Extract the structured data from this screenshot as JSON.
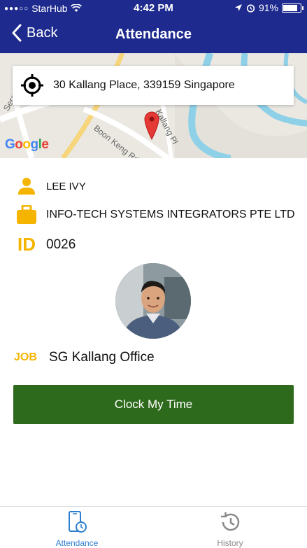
{
  "status_bar": {
    "carrier": "StarHub",
    "time": "4:42 PM",
    "battery_percent": "91%",
    "battery_level": 0.91
  },
  "nav": {
    "back_label": "Back",
    "title": "Attendance"
  },
  "map": {
    "address": "30 Kallang Place, 339159 Singapore",
    "street_labels": [
      "Boon Keng Rd",
      "Kallang Pl",
      "Serangoon"
    ],
    "logo_text": "Google"
  },
  "employee": {
    "name": "LEE IVY",
    "company": "INFO-TECH SYSTEMS INTEGRATORS PTE LTD",
    "id_label": "ID",
    "id_value": "0026",
    "job_label": "JOB",
    "job_value": "SG Kallang Office"
  },
  "actions": {
    "clock_label": "Clock My Time"
  },
  "tabs": [
    {
      "label": "Attendance",
      "icon": "phone-clock-icon",
      "active": true
    },
    {
      "label": "History",
      "icon": "history-icon",
      "active": false
    }
  ],
  "colors": {
    "nav_bg": "#1e2a8e",
    "accent_yellow": "#f5b400",
    "button_green": "#2e6a1c",
    "tab_active": "#2f7fd0",
    "tab_inactive": "#8a8a8a"
  }
}
